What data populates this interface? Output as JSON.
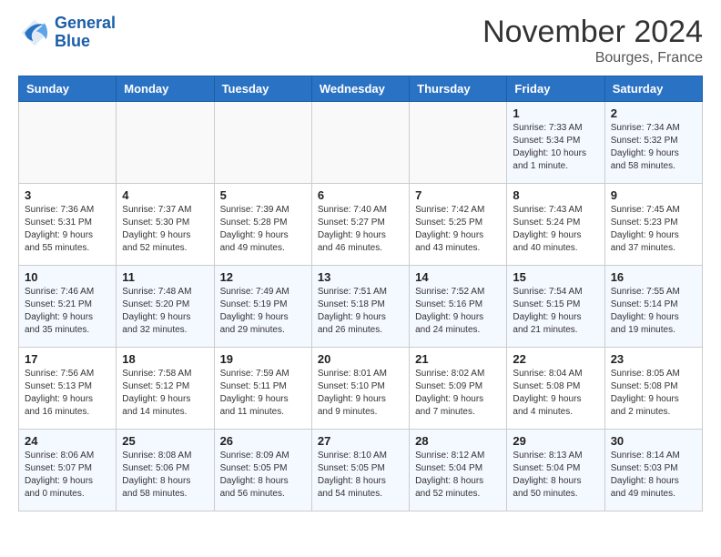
{
  "header": {
    "logo_line1": "General",
    "logo_line2": "Blue",
    "month": "November 2024",
    "location": "Bourges, France"
  },
  "days_of_week": [
    "Sunday",
    "Monday",
    "Tuesday",
    "Wednesday",
    "Thursday",
    "Friday",
    "Saturday"
  ],
  "weeks": [
    [
      {
        "day": "",
        "info": ""
      },
      {
        "day": "",
        "info": ""
      },
      {
        "day": "",
        "info": ""
      },
      {
        "day": "",
        "info": ""
      },
      {
        "day": "",
        "info": ""
      },
      {
        "day": "1",
        "info": "Sunrise: 7:33 AM\nSunset: 5:34 PM\nDaylight: 10 hours\nand 1 minute."
      },
      {
        "day": "2",
        "info": "Sunrise: 7:34 AM\nSunset: 5:32 PM\nDaylight: 9 hours\nand 58 minutes."
      }
    ],
    [
      {
        "day": "3",
        "info": "Sunrise: 7:36 AM\nSunset: 5:31 PM\nDaylight: 9 hours\nand 55 minutes."
      },
      {
        "day": "4",
        "info": "Sunrise: 7:37 AM\nSunset: 5:30 PM\nDaylight: 9 hours\nand 52 minutes."
      },
      {
        "day": "5",
        "info": "Sunrise: 7:39 AM\nSunset: 5:28 PM\nDaylight: 9 hours\nand 49 minutes."
      },
      {
        "day": "6",
        "info": "Sunrise: 7:40 AM\nSunset: 5:27 PM\nDaylight: 9 hours\nand 46 minutes."
      },
      {
        "day": "7",
        "info": "Sunrise: 7:42 AM\nSunset: 5:25 PM\nDaylight: 9 hours\nand 43 minutes."
      },
      {
        "day": "8",
        "info": "Sunrise: 7:43 AM\nSunset: 5:24 PM\nDaylight: 9 hours\nand 40 minutes."
      },
      {
        "day": "9",
        "info": "Sunrise: 7:45 AM\nSunset: 5:23 PM\nDaylight: 9 hours\nand 37 minutes."
      }
    ],
    [
      {
        "day": "10",
        "info": "Sunrise: 7:46 AM\nSunset: 5:21 PM\nDaylight: 9 hours\nand 35 minutes."
      },
      {
        "day": "11",
        "info": "Sunrise: 7:48 AM\nSunset: 5:20 PM\nDaylight: 9 hours\nand 32 minutes."
      },
      {
        "day": "12",
        "info": "Sunrise: 7:49 AM\nSunset: 5:19 PM\nDaylight: 9 hours\nand 29 minutes."
      },
      {
        "day": "13",
        "info": "Sunrise: 7:51 AM\nSunset: 5:18 PM\nDaylight: 9 hours\nand 26 minutes."
      },
      {
        "day": "14",
        "info": "Sunrise: 7:52 AM\nSunset: 5:16 PM\nDaylight: 9 hours\nand 24 minutes."
      },
      {
        "day": "15",
        "info": "Sunrise: 7:54 AM\nSunset: 5:15 PM\nDaylight: 9 hours\nand 21 minutes."
      },
      {
        "day": "16",
        "info": "Sunrise: 7:55 AM\nSunset: 5:14 PM\nDaylight: 9 hours\nand 19 minutes."
      }
    ],
    [
      {
        "day": "17",
        "info": "Sunrise: 7:56 AM\nSunset: 5:13 PM\nDaylight: 9 hours\nand 16 minutes."
      },
      {
        "day": "18",
        "info": "Sunrise: 7:58 AM\nSunset: 5:12 PM\nDaylight: 9 hours\nand 14 minutes."
      },
      {
        "day": "19",
        "info": "Sunrise: 7:59 AM\nSunset: 5:11 PM\nDaylight: 9 hours\nand 11 minutes."
      },
      {
        "day": "20",
        "info": "Sunrise: 8:01 AM\nSunset: 5:10 PM\nDaylight: 9 hours\nand 9 minutes."
      },
      {
        "day": "21",
        "info": "Sunrise: 8:02 AM\nSunset: 5:09 PM\nDaylight: 9 hours\nand 7 minutes."
      },
      {
        "day": "22",
        "info": "Sunrise: 8:04 AM\nSunset: 5:08 PM\nDaylight: 9 hours\nand 4 minutes."
      },
      {
        "day": "23",
        "info": "Sunrise: 8:05 AM\nSunset: 5:08 PM\nDaylight: 9 hours\nand 2 minutes."
      }
    ],
    [
      {
        "day": "24",
        "info": "Sunrise: 8:06 AM\nSunset: 5:07 PM\nDaylight: 9 hours\nand 0 minutes."
      },
      {
        "day": "25",
        "info": "Sunrise: 8:08 AM\nSunset: 5:06 PM\nDaylight: 8 hours\nand 58 minutes."
      },
      {
        "day": "26",
        "info": "Sunrise: 8:09 AM\nSunset: 5:05 PM\nDaylight: 8 hours\nand 56 minutes."
      },
      {
        "day": "27",
        "info": "Sunrise: 8:10 AM\nSunset: 5:05 PM\nDaylight: 8 hours\nand 54 minutes."
      },
      {
        "day": "28",
        "info": "Sunrise: 8:12 AM\nSunset: 5:04 PM\nDaylight: 8 hours\nand 52 minutes."
      },
      {
        "day": "29",
        "info": "Sunrise: 8:13 AM\nSunset: 5:04 PM\nDaylight: 8 hours\nand 50 minutes."
      },
      {
        "day": "30",
        "info": "Sunrise: 8:14 AM\nSunset: 5:03 PM\nDaylight: 8 hours\nand 49 minutes."
      }
    ]
  ]
}
